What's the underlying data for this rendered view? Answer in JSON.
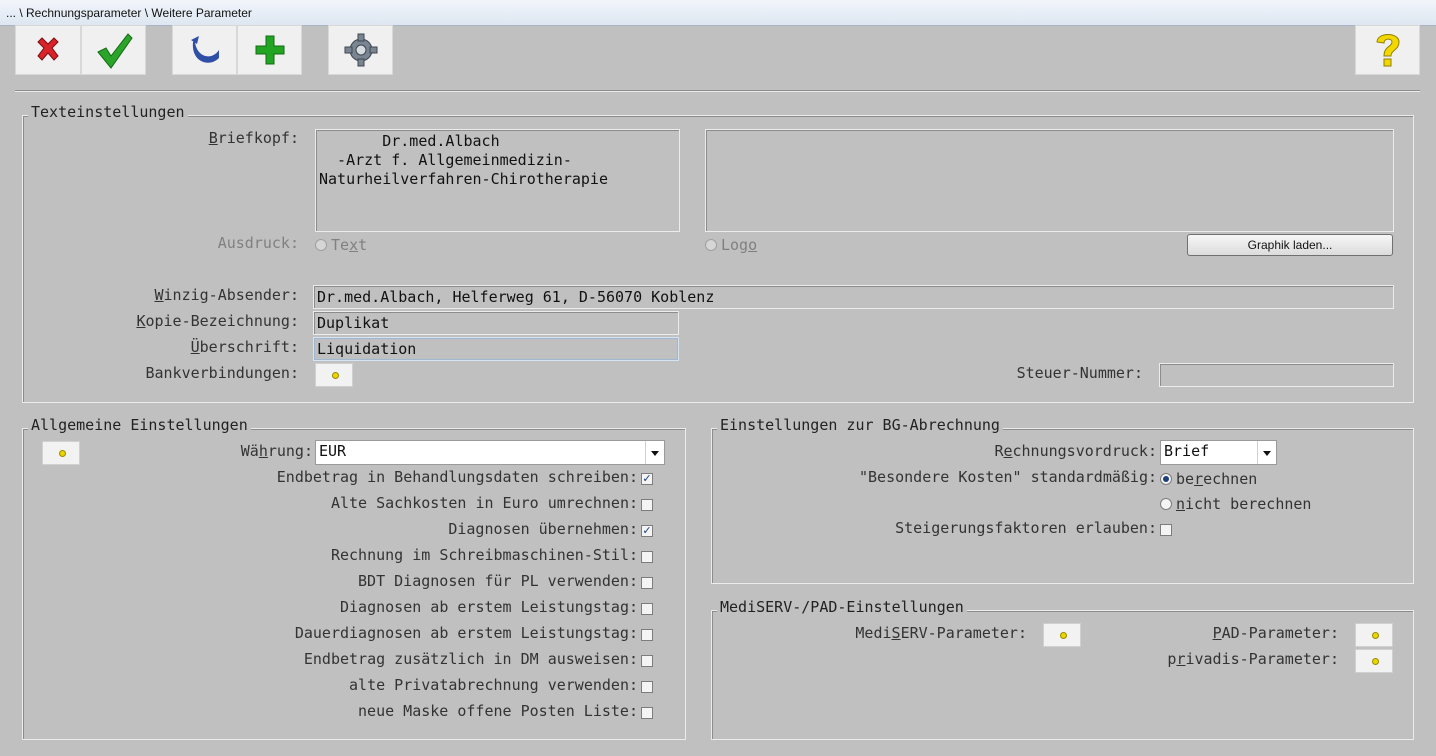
{
  "window": {
    "title": "... \\ Rechnungsparameter \\ Weitere Parameter"
  },
  "toolbar": {
    "icons": [
      "close-icon",
      "check-icon",
      "undo-icon",
      "add-icon",
      "gear-icon",
      "help-icon"
    ],
    "colors": {
      "close": "#d8232a",
      "check": "#2aa52a",
      "undo": "#2e4fa5",
      "add": "#22a522",
      "help": "#f2d800"
    }
  },
  "text_settings": {
    "legend": "Texteinstellungen",
    "briefkopf_label": "Briefkopf:",
    "briefkopf_text": "       Dr.med.Albach\n  -Arzt f. Allgemeinmedizin-\nNaturheilverfahren-Chirotherapie",
    "ausdruck_label": "Ausdruck:",
    "radio_text": "Text",
    "radio_logo": "Logo",
    "load_graphic_button": "Graphik laden...",
    "winzig_label": "Winzig-Absender:",
    "winzig_value": "Dr.med.Albach, Helferweg 61, D-56070 Koblenz",
    "kopie_label": "Kopie-Bezeichnung:",
    "kopie_value": "Duplikat",
    "ueberschrift_label": "Überschrift:",
    "ueberschrift_value": "Liquidation",
    "bank_label": "Bankverbindungen:",
    "steuer_label": "Steuer-Nummer:",
    "steuer_value": ""
  },
  "general": {
    "legend": "Allgemeine Einstellungen",
    "currency_label": "Währung:",
    "currency_value": "EUR",
    "options": [
      {
        "label": "Endbetrag in Behandlungsdaten schreiben:",
        "checked": true
      },
      {
        "label": "Alte Sachkosten in Euro umrechnen:",
        "checked": false
      },
      {
        "label": "Diagnosen übernehmen:",
        "checked": true
      },
      {
        "label": "Rechnung im Schreibmaschinen-Stil:",
        "checked": false
      },
      {
        "label": "BDT Diagnosen für PL verwenden:",
        "checked": false
      },
      {
        "label": "Diagnosen ab erstem Leistungstag:",
        "checked": false
      },
      {
        "label": "Dauerdiagnosen ab erstem Leistungstag:",
        "checked": false
      },
      {
        "label": "Endbetrag zusätzlich in DM ausweisen:",
        "checked": false
      },
      {
        "label": "alte Privatabrechnung verwenden:",
        "checked": false
      },
      {
        "label": "neue Maske offene Posten Liste:",
        "checked": false
      }
    ],
    "check_mark": "✓"
  },
  "bg": {
    "legend": "Einstellungen zur BG-Abrechnung",
    "vordruck_label": "Rechnungsvordruck:",
    "vordruck_value": "Brief",
    "kosten_label": "\"Besondere Kosten\" standardmäßig:",
    "radio_berechnen": "berechnen",
    "radio_nicht": "nicht berechnen",
    "steigerung_label": "Steigerungsfaktoren erlauben:"
  },
  "mediserv": {
    "legend": "MediSERV-/PAD-Einstellungen",
    "mediserv_label": "MediSERV-Parameter:",
    "pad_label": "PAD-Parameter:",
    "privadis_label": "privadis-Parameter:"
  }
}
